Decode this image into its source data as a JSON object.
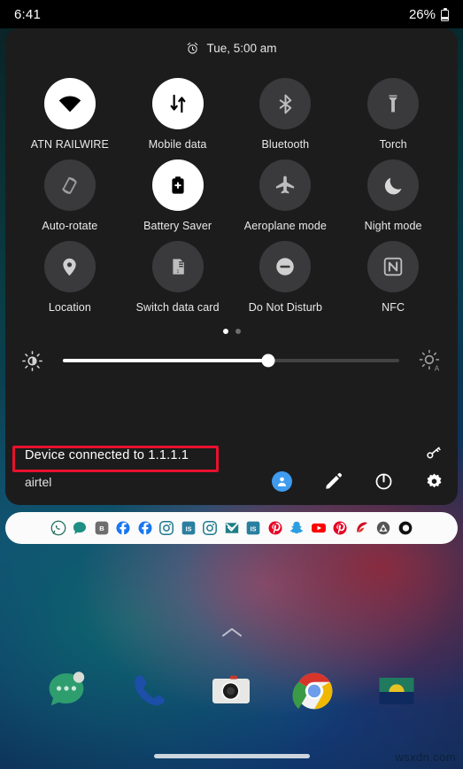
{
  "status_bar": {
    "time": "6:41",
    "battery_percent": "26%",
    "battery_icon": "battery-low-icon"
  },
  "quick_settings": {
    "header": {
      "alarm_icon": "alarm-clock-icon",
      "alarm_text": "Tue, 5:00 am"
    },
    "tiles": [
      {
        "label": "ATN RAILWIRE",
        "icon": "wifi-icon",
        "state": "on"
      },
      {
        "label": "Mobile data",
        "icon": "mobile-data-icon",
        "state": "on"
      },
      {
        "label": "Bluetooth",
        "icon": "bluetooth-icon",
        "state": "off"
      },
      {
        "label": "Torch",
        "icon": "flashlight-icon",
        "state": "off"
      },
      {
        "label": "Auto-rotate",
        "icon": "auto-rotate-icon",
        "state": "off"
      },
      {
        "label": "Battery Saver",
        "icon": "battery-saver-icon",
        "state": "on"
      },
      {
        "label": "Aeroplane mode",
        "icon": "airplane-icon",
        "state": "off"
      },
      {
        "label": "Night mode",
        "icon": "moon-icon",
        "state": "off"
      },
      {
        "label": "Location",
        "icon": "location-pin-icon",
        "state": "off"
      },
      {
        "label": "Switch data card",
        "icon": "sim-card-icon",
        "state": "off"
      },
      {
        "label": "Do Not Disturb",
        "icon": "do-not-disturb-icon",
        "state": "off"
      },
      {
        "label": "NFC",
        "icon": "nfc-icon",
        "state": "off"
      }
    ],
    "page_dots": {
      "count": 2,
      "active_index": 0
    },
    "brightness": {
      "low_icon": "brightness-low-icon",
      "auto_icon": "brightness-auto-icon",
      "value_percent": 61
    },
    "footer": {
      "device_connected_text": "Device connected to 1.1.1.1",
      "carrier": "airtel",
      "vpn_icon": "vpn-key-icon",
      "actions": [
        {
          "name": "user-avatar",
          "icon": "person-icon"
        },
        {
          "name": "edit-tiles",
          "icon": "pencil-icon"
        },
        {
          "name": "power-menu",
          "icon": "power-icon"
        },
        {
          "name": "settings",
          "icon": "gear-icon"
        }
      ]
    },
    "annotation": {
      "highlight_color": "#e8112d",
      "target": "device-connected-text"
    }
  },
  "app_icon_strip": [
    {
      "name": "whatsapp",
      "color": "#ffffff"
    },
    {
      "name": "chat",
      "color": "#1f8f84"
    },
    {
      "name": "b-app",
      "color": "#6e6e6e"
    },
    {
      "name": "facebook-1",
      "color": "#1877f2"
    },
    {
      "name": "facebook-2",
      "color": "#1877f2"
    },
    {
      "name": "instagram-1",
      "color": "#1f7a8c"
    },
    {
      "name": "is-app-1",
      "color": "#2a7fa0"
    },
    {
      "name": "instagram-2",
      "color": "#1f7a8c"
    },
    {
      "name": "mail-check",
      "color": "#1f7f86"
    },
    {
      "name": "is-app-2",
      "color": "#2a7fa0"
    },
    {
      "name": "pinterest-1",
      "color": "#e60023"
    },
    {
      "name": "snapchat",
      "color": "#2b9fe0"
    },
    {
      "name": "youtube",
      "color": "#ff0000"
    },
    {
      "name": "pinterest-2",
      "color": "#e60023"
    },
    {
      "name": "red-app",
      "color": "#cc1122"
    },
    {
      "name": "triangle-app",
      "color": "#555555"
    },
    {
      "name": "ring-app",
      "color": "#111111"
    }
  ],
  "home_screen": {
    "drawer_indicator_icon": "chevron-up-icon",
    "dock": [
      {
        "name": "messages-app",
        "icon": "messages-icon"
      },
      {
        "name": "phone-app",
        "icon": "phone-icon"
      },
      {
        "name": "camera-app",
        "icon": "camera-icon"
      },
      {
        "name": "chrome-app",
        "icon": "chrome-icon"
      },
      {
        "name": "gallery-app",
        "icon": "gallery-icon"
      }
    ],
    "nav_pill": "home-gesture-pill"
  },
  "watermark": "wsxdn.com"
}
